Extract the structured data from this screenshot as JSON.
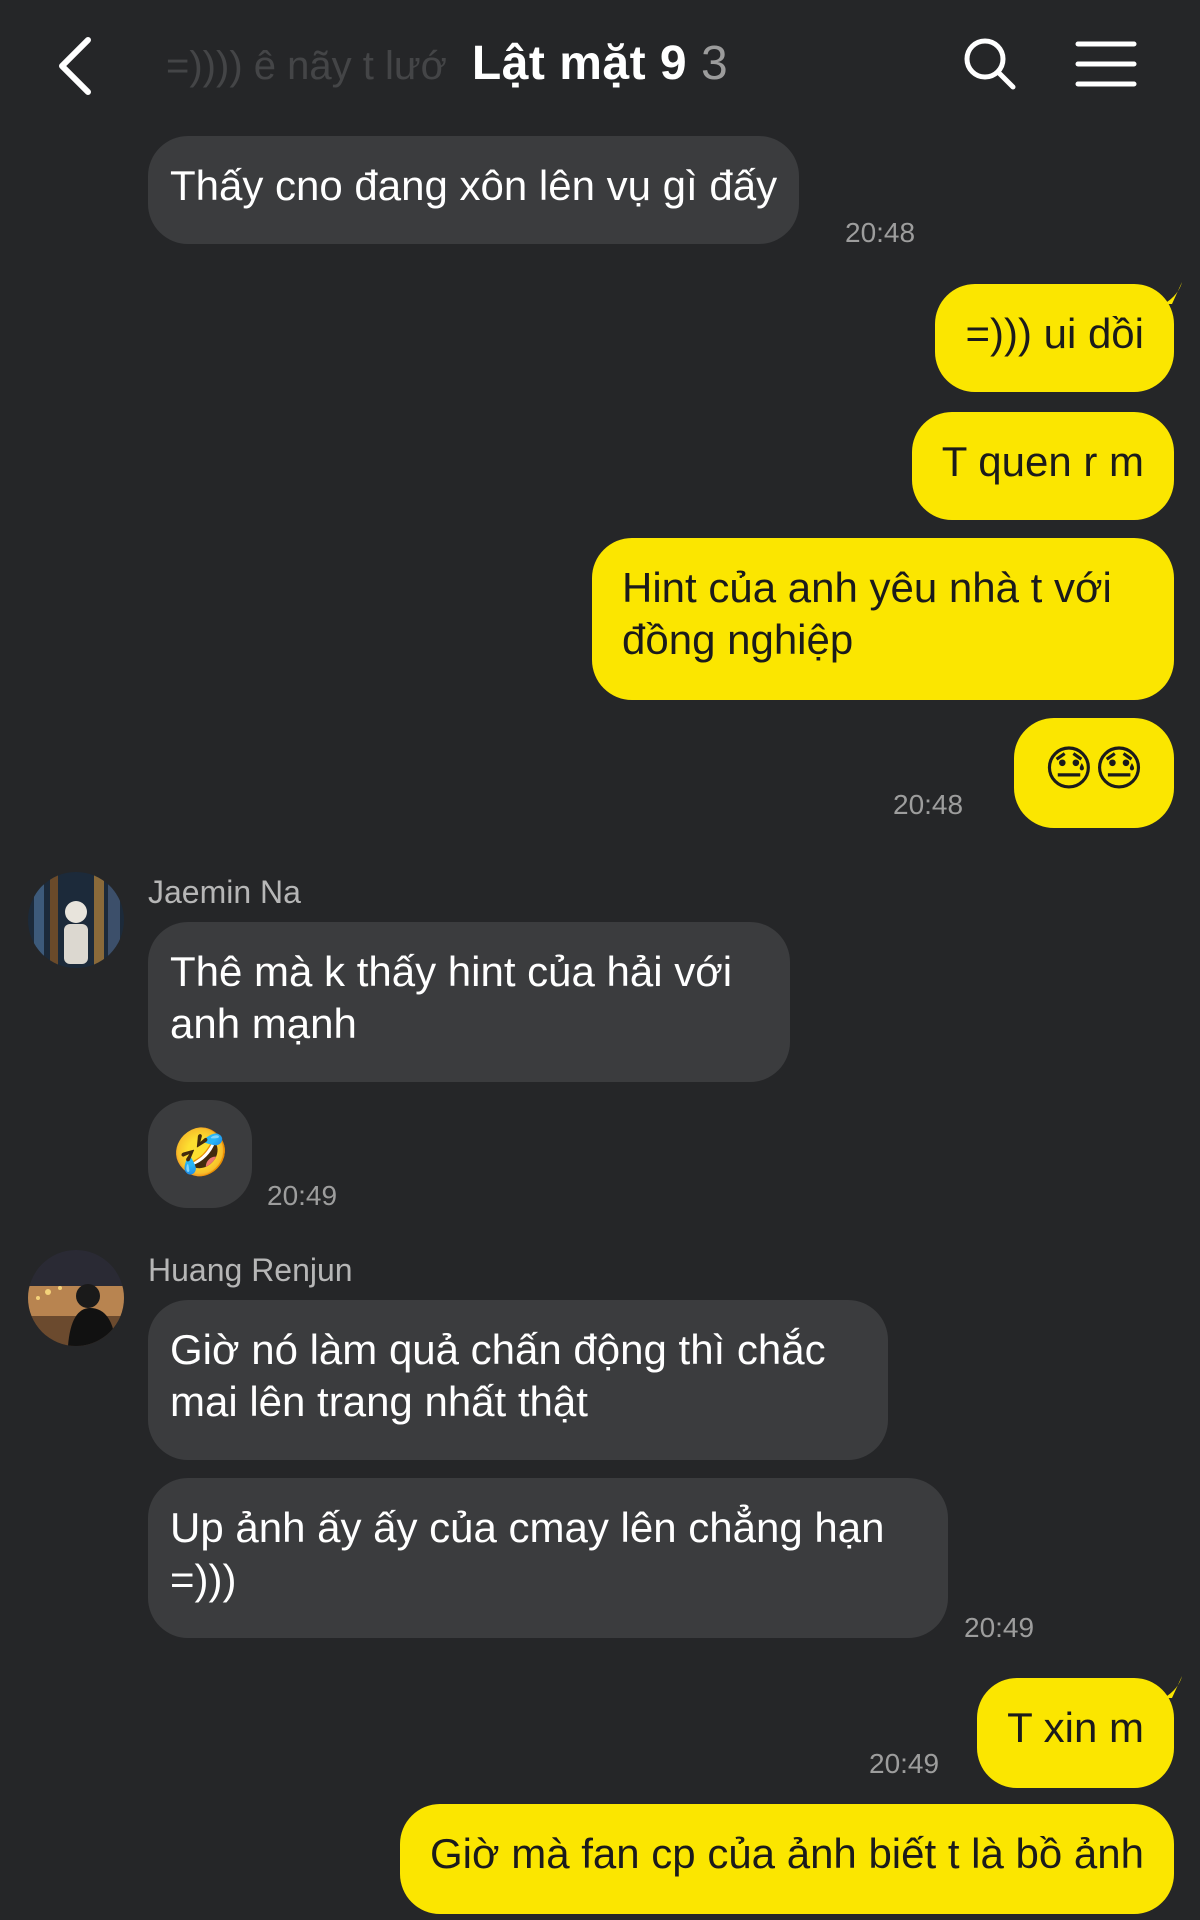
{
  "header": {
    "title": "Lật mặt 9",
    "member_count": "3",
    "faded_preview": "=)))) ê nãy t lướ"
  },
  "messages": [
    {
      "sender": "",
      "direction": "in",
      "text": "Thấy cno đang xôn lên vụ gì đấy",
      "time": "20:48"
    },
    {
      "direction": "out",
      "text": "=))) ui dồi"
    },
    {
      "direction": "out",
      "text": "T quen r m"
    },
    {
      "direction": "out",
      "text": "Hint của anh yêu nhà t với đồng nghiệp"
    },
    {
      "direction": "out",
      "text": "😓😓",
      "time": "20:48"
    },
    {
      "sender": "Jaemin Na",
      "direction": "in",
      "text": "Thê mà k thấy hint của hải với anh mạnh"
    },
    {
      "direction": "in",
      "text": "🤣",
      "time": "20:49"
    },
    {
      "sender": "Huang Renjun",
      "direction": "in",
      "text": "Giờ nó làm quả chấn động thì chắc mai lên trang nhất thật"
    },
    {
      "direction": "in",
      "text": "Up ảnh ấy ấy của cmay lên chẳng hạn =)))",
      "time": "20:49"
    },
    {
      "direction": "out",
      "text": "T xin m",
      "time": "20:49"
    },
    {
      "direction": "out",
      "text": "Giờ mà fan cp của ảnh biết t là bồ ảnh"
    }
  ],
  "colors": {
    "background": "#252628",
    "incoming_bubble": "#3b3c3e",
    "outgoing_bubble": "#fbe600"
  },
  "icons": {
    "back": "chevron-left-icon",
    "search": "search-icon",
    "menu": "hamburger-menu-icon"
  }
}
